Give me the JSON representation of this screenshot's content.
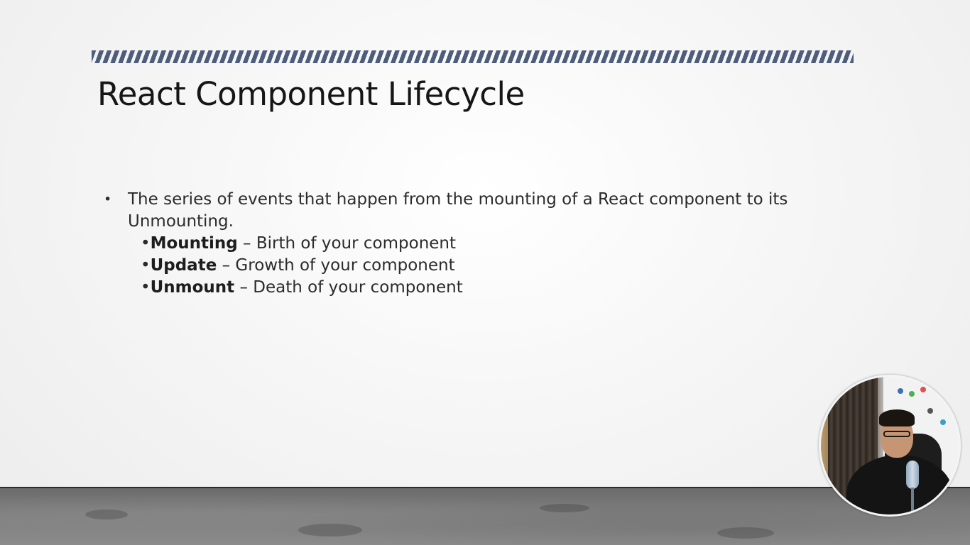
{
  "slide": {
    "title": "React Component Lifecycle",
    "bullet_symbol": "•",
    "intro_line_1": "The series of events that happen from the mounting of a React component to its",
    "intro_line_2": "Unmounting.",
    "sub_items": [
      {
        "prefix": "•",
        "term": "Mounting",
        "description": " – Birth of your component"
      },
      {
        "prefix": "•",
        "term": "Update",
        "description": " – Growth of your component"
      },
      {
        "prefix": "•",
        "term": "Unmount",
        "description": " – Death of your component"
      }
    ]
  },
  "theme": {
    "stripe_color": "#4e5d7c",
    "title_color": "#161616",
    "text_color": "#2b2b2b",
    "floor_color": "#7d7d7d"
  },
  "webcam": {
    "icon": "presenter-webcam-icon"
  }
}
